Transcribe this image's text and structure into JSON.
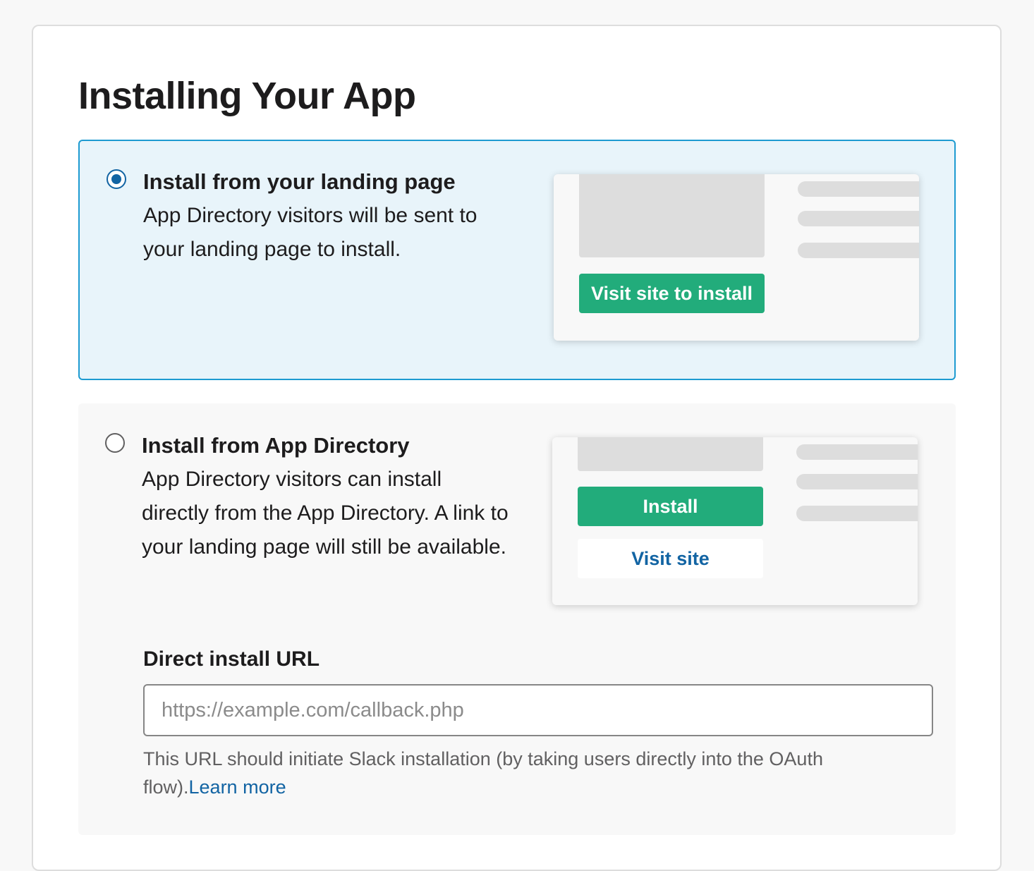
{
  "page": {
    "title": "Installing Your App"
  },
  "options": {
    "landing": {
      "title": "Install from your landing page",
      "description": "App Directory visitors will be sent to your landing page to install.",
      "selected": true,
      "preview": {
        "button_label": "Visit site to install"
      }
    },
    "directory": {
      "title": "Install from App Directory",
      "description": "App Directory visitors can install directly from the App Directory. A link to your landing page will still be available.",
      "selected": false,
      "preview": {
        "install_label": "Install",
        "visit_label": "Visit site"
      },
      "direct_install": {
        "label": "Direct install URL",
        "value": "",
        "placeholder": "https://example.com/callback.php",
        "help_text": "This URL should initiate Slack installation (by taking users directly into the OAuth flow).",
        "help_link": "Learn more"
      }
    }
  },
  "colors": {
    "selected_bg": "#e8f4fa",
    "selected_border": "#1d9bd1",
    "radio_accent": "#1264a3",
    "button_green": "#22ac7b",
    "link_blue": "#1264a3"
  }
}
